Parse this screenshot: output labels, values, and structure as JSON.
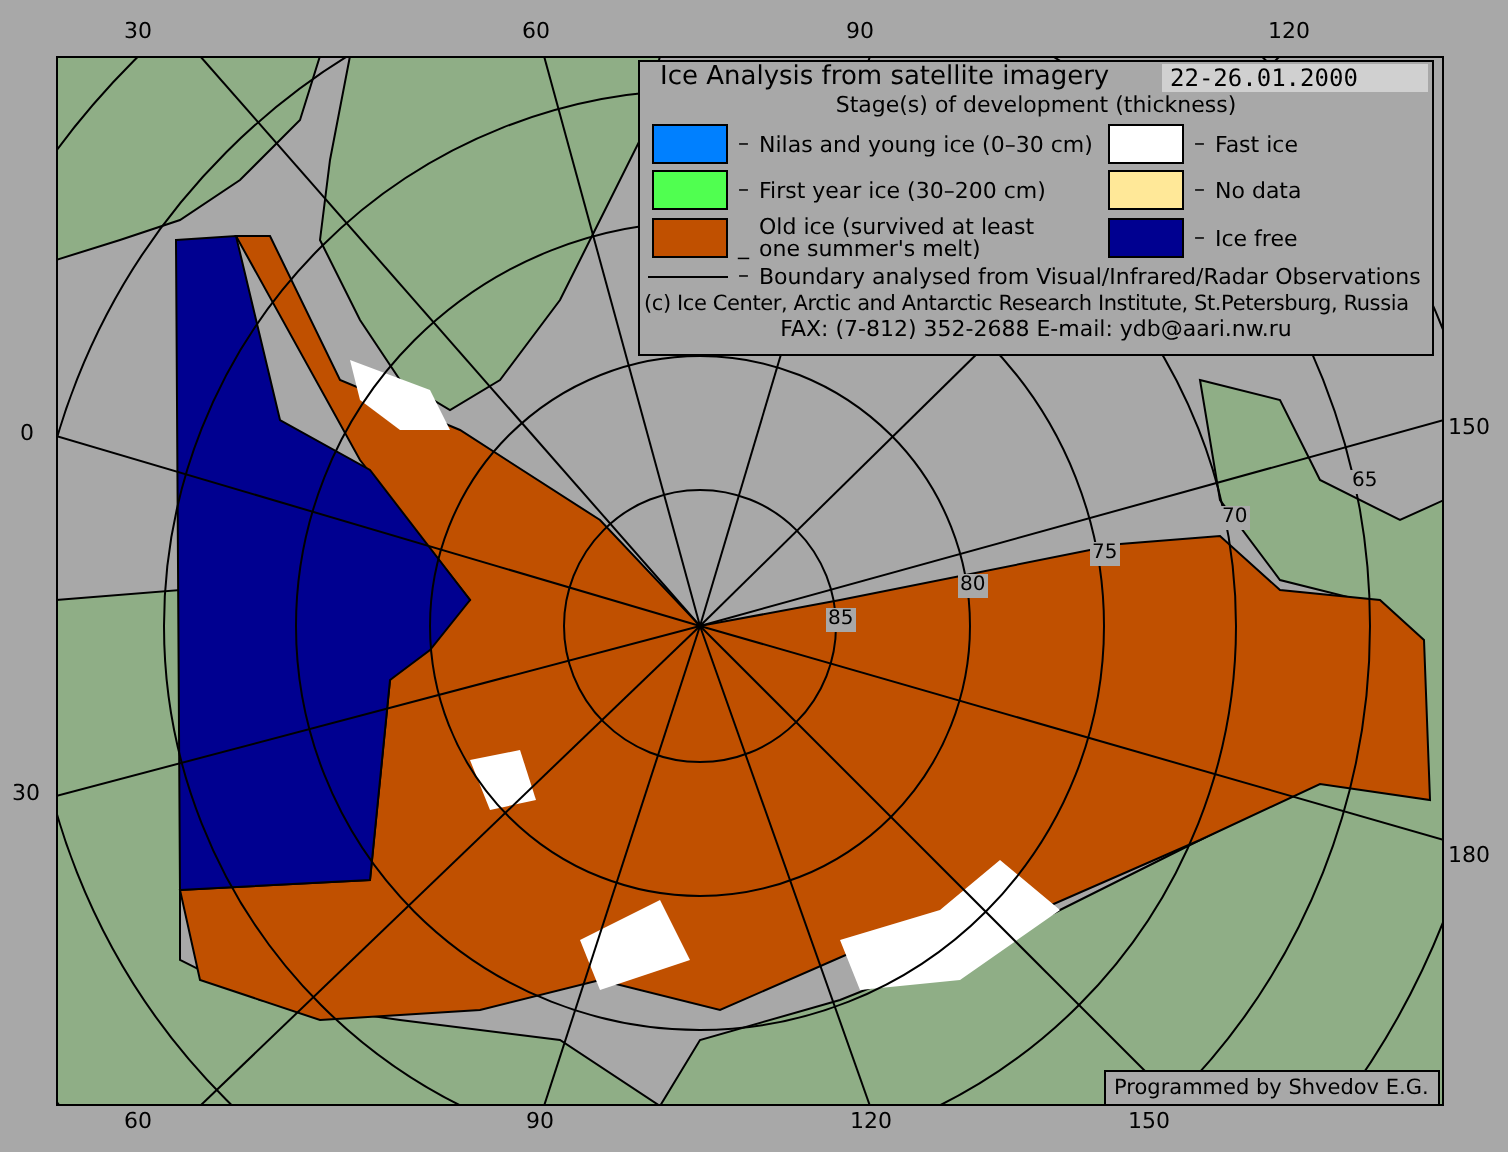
{
  "map": {
    "top_labels": [
      "30",
      "60",
      "90",
      "120"
    ],
    "bottom_labels": [
      "60",
      "90",
      "120",
      "150"
    ],
    "left_labels": [
      "0",
      "30"
    ],
    "right_labels": [
      "150",
      "180"
    ],
    "latitude_labels": [
      "85",
      "80",
      "75",
      "70",
      "65"
    ]
  },
  "legend": {
    "title": "Ice Analysis from satellite imagery",
    "date": "22-26.01.2000",
    "subtitle": "Stage(s) of development (thickness)",
    "items": [
      {
        "dash": "–",
        "label": "Nilas and young ice (0–30 cm)",
        "color": "#0080ff"
      },
      {
        "dash": "–",
        "label": "Fast ice",
        "color": "#ffffff"
      },
      {
        "dash": "–",
        "label": "First year ice (30–200 cm)",
        "color": "#50ff50"
      },
      {
        "dash": "–",
        "label": "No data",
        "color": "#ffe898"
      },
      {
        "dash": "_",
        "label": "Old ice (survived at least one summer's melt)",
        "color": "#c05000"
      },
      {
        "dash": "–",
        "label": "Ice free",
        "color": "#000090"
      }
    ],
    "boundary": {
      "dash": "–",
      "label": "Boundary analysed from Visual/Infrared/Radar Observations"
    },
    "copyright": "(c) Ice Center, Arctic and Antarctic Research Institute, St.Petersburg, Russia",
    "contact": "FAX: (7-812) 352-2688 E-mail: ydb@aari.nw.ru"
  },
  "credit": "Programmed by Shvedov E.G."
}
